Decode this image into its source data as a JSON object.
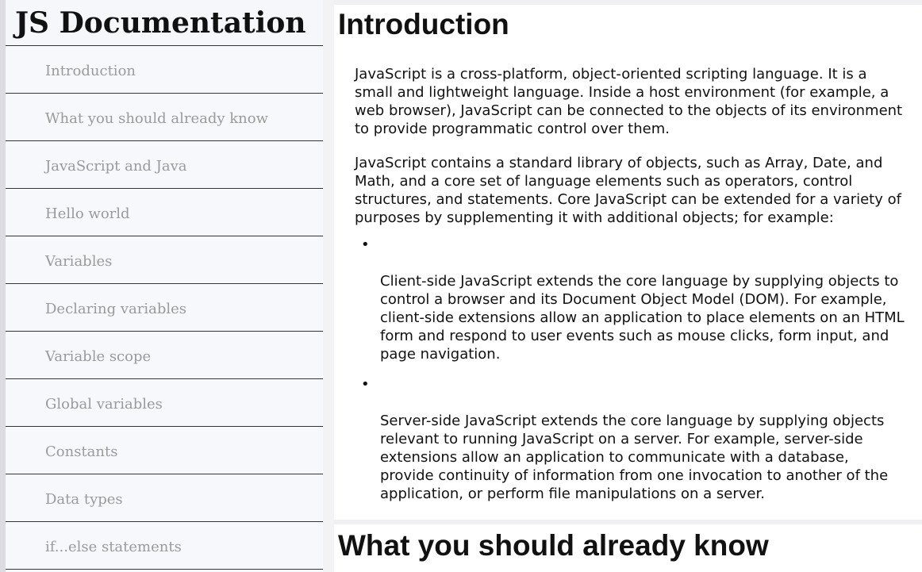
{
  "navbar": {
    "title": "JS Documentation",
    "items": [
      {
        "label": "Introduction"
      },
      {
        "label": "What you should already know"
      },
      {
        "label": "JavaScript and Java"
      },
      {
        "label": "Hello world"
      },
      {
        "label": "Variables"
      },
      {
        "label": "Declaring variables"
      },
      {
        "label": "Variable scope"
      },
      {
        "label": "Global variables"
      },
      {
        "label": "Constants"
      },
      {
        "label": "Data types"
      },
      {
        "label": "if...else statements"
      }
    ]
  },
  "main": {
    "sections": [
      {
        "heading": "Introduction",
        "paragraphs": [
          "JavaScript is a cross-platform, object-oriented scripting language. It is a small and lightweight language. Inside a host environment (for example, a web browser), JavaScript can be connected to the objects of its environment to provide programmatic control over them.",
          "JavaScript contains a standard library of objects, such as Array, Date, and Math, and a core set of language elements such as operators, control structures, and statements. Core JavaScript can be extended for a variety of purposes by supplementing it with additional objects; for example:"
        ],
        "list": [
          "Client-side JavaScript extends the core language by supplying objects to control a browser and its Document Object Model (DOM). For example, client-side extensions allow an application to place elements on an HTML form and respond to user events such as mouse clicks, form input, and page navigation.",
          "Server-side JavaScript extends the core language by supplying objects relevant to running JavaScript on a server. For example, server-side extensions allow an application to communicate with a database, provide continuity of information from one invocation to another of the application, or perform file manipulations on a server."
        ]
      },
      {
        "heading": "What you should already know"
      }
    ]
  },
  "bullet_glyph": "•"
}
